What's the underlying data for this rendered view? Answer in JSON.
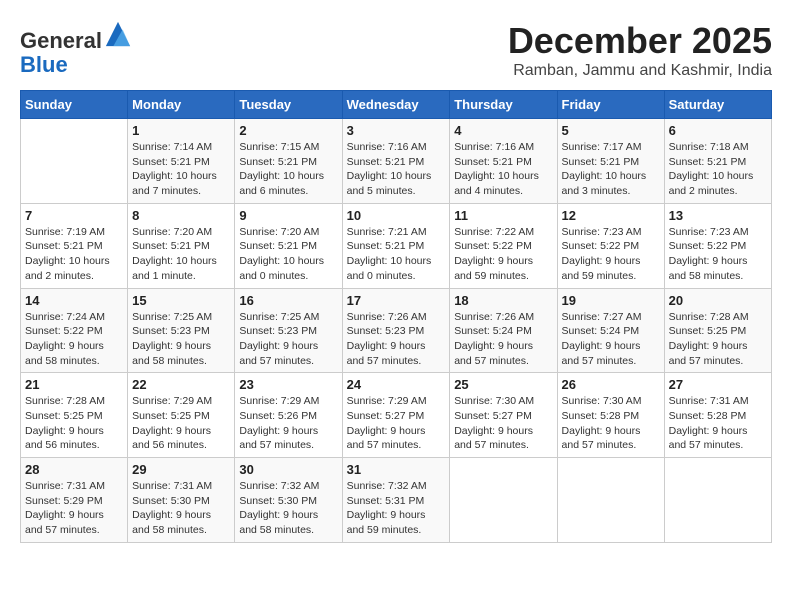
{
  "header": {
    "logo_general": "General",
    "logo_blue": "Blue",
    "month_year": "December 2025",
    "location": "Ramban, Jammu and Kashmir, India"
  },
  "calendar": {
    "columns": [
      "Sunday",
      "Monday",
      "Tuesday",
      "Wednesday",
      "Thursday",
      "Friday",
      "Saturday"
    ],
    "weeks": [
      [
        {
          "day": "",
          "info": ""
        },
        {
          "day": "1",
          "info": "Sunrise: 7:14 AM\nSunset: 5:21 PM\nDaylight: 10 hours\nand 7 minutes."
        },
        {
          "day": "2",
          "info": "Sunrise: 7:15 AM\nSunset: 5:21 PM\nDaylight: 10 hours\nand 6 minutes."
        },
        {
          "day": "3",
          "info": "Sunrise: 7:16 AM\nSunset: 5:21 PM\nDaylight: 10 hours\nand 5 minutes."
        },
        {
          "day": "4",
          "info": "Sunrise: 7:16 AM\nSunset: 5:21 PM\nDaylight: 10 hours\nand 4 minutes."
        },
        {
          "day": "5",
          "info": "Sunrise: 7:17 AM\nSunset: 5:21 PM\nDaylight: 10 hours\nand 3 minutes."
        },
        {
          "day": "6",
          "info": "Sunrise: 7:18 AM\nSunset: 5:21 PM\nDaylight: 10 hours\nand 2 minutes."
        }
      ],
      [
        {
          "day": "7",
          "info": "Sunrise: 7:19 AM\nSunset: 5:21 PM\nDaylight: 10 hours\nand 2 minutes."
        },
        {
          "day": "8",
          "info": "Sunrise: 7:20 AM\nSunset: 5:21 PM\nDaylight: 10 hours\nand 1 minute."
        },
        {
          "day": "9",
          "info": "Sunrise: 7:20 AM\nSunset: 5:21 PM\nDaylight: 10 hours\nand 0 minutes."
        },
        {
          "day": "10",
          "info": "Sunrise: 7:21 AM\nSunset: 5:21 PM\nDaylight: 10 hours\nand 0 minutes."
        },
        {
          "day": "11",
          "info": "Sunrise: 7:22 AM\nSunset: 5:22 PM\nDaylight: 9 hours\nand 59 minutes."
        },
        {
          "day": "12",
          "info": "Sunrise: 7:23 AM\nSunset: 5:22 PM\nDaylight: 9 hours\nand 59 minutes."
        },
        {
          "day": "13",
          "info": "Sunrise: 7:23 AM\nSunset: 5:22 PM\nDaylight: 9 hours\nand 58 minutes."
        }
      ],
      [
        {
          "day": "14",
          "info": "Sunrise: 7:24 AM\nSunset: 5:22 PM\nDaylight: 9 hours\nand 58 minutes."
        },
        {
          "day": "15",
          "info": "Sunrise: 7:25 AM\nSunset: 5:23 PM\nDaylight: 9 hours\nand 58 minutes."
        },
        {
          "day": "16",
          "info": "Sunrise: 7:25 AM\nSunset: 5:23 PM\nDaylight: 9 hours\nand 57 minutes."
        },
        {
          "day": "17",
          "info": "Sunrise: 7:26 AM\nSunset: 5:23 PM\nDaylight: 9 hours\nand 57 minutes."
        },
        {
          "day": "18",
          "info": "Sunrise: 7:26 AM\nSunset: 5:24 PM\nDaylight: 9 hours\nand 57 minutes."
        },
        {
          "day": "19",
          "info": "Sunrise: 7:27 AM\nSunset: 5:24 PM\nDaylight: 9 hours\nand 57 minutes."
        },
        {
          "day": "20",
          "info": "Sunrise: 7:28 AM\nSunset: 5:25 PM\nDaylight: 9 hours\nand 57 minutes."
        }
      ],
      [
        {
          "day": "21",
          "info": "Sunrise: 7:28 AM\nSunset: 5:25 PM\nDaylight: 9 hours\nand 56 minutes."
        },
        {
          "day": "22",
          "info": "Sunrise: 7:29 AM\nSunset: 5:25 PM\nDaylight: 9 hours\nand 56 minutes."
        },
        {
          "day": "23",
          "info": "Sunrise: 7:29 AM\nSunset: 5:26 PM\nDaylight: 9 hours\nand 57 minutes."
        },
        {
          "day": "24",
          "info": "Sunrise: 7:29 AM\nSunset: 5:27 PM\nDaylight: 9 hours\nand 57 minutes."
        },
        {
          "day": "25",
          "info": "Sunrise: 7:30 AM\nSunset: 5:27 PM\nDaylight: 9 hours\nand 57 minutes."
        },
        {
          "day": "26",
          "info": "Sunrise: 7:30 AM\nSunset: 5:28 PM\nDaylight: 9 hours\nand 57 minutes."
        },
        {
          "day": "27",
          "info": "Sunrise: 7:31 AM\nSunset: 5:28 PM\nDaylight: 9 hours\nand 57 minutes."
        }
      ],
      [
        {
          "day": "28",
          "info": "Sunrise: 7:31 AM\nSunset: 5:29 PM\nDaylight: 9 hours\nand 57 minutes."
        },
        {
          "day": "29",
          "info": "Sunrise: 7:31 AM\nSunset: 5:30 PM\nDaylight: 9 hours\nand 58 minutes."
        },
        {
          "day": "30",
          "info": "Sunrise: 7:32 AM\nSunset: 5:30 PM\nDaylight: 9 hours\nand 58 minutes."
        },
        {
          "day": "31",
          "info": "Sunrise: 7:32 AM\nSunset: 5:31 PM\nDaylight: 9 hours\nand 59 minutes."
        },
        {
          "day": "",
          "info": ""
        },
        {
          "day": "",
          "info": ""
        },
        {
          "day": "",
          "info": ""
        }
      ]
    ]
  }
}
